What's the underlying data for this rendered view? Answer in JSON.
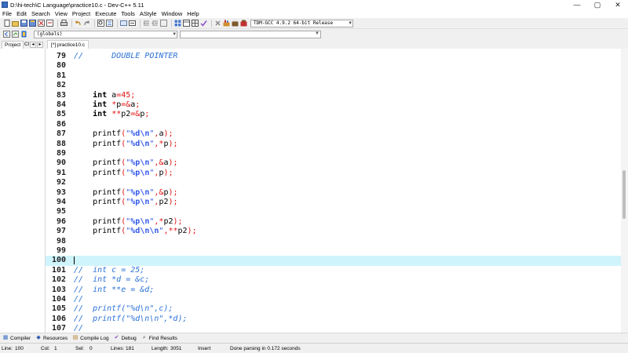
{
  "window": {
    "title": "D:\\hi-tech\\C Language\\practice10.c - Dev-C++ 5.11",
    "controls": [
      "—",
      "▢",
      "✕"
    ]
  },
  "menu": [
    "File",
    "Edit",
    "Search",
    "View",
    "Project",
    "Execute",
    "Tools",
    "AStyle",
    "Window",
    "Help"
  ],
  "toolbar": {
    "compiler_select": "TDM-GCC 4.9.2 64-bit Release",
    "scope_select": "(globals)",
    "members_select": ""
  },
  "panels": {
    "project_tab": "Project",
    "classes_tab": "Cl",
    "scroll_left": "◂",
    "scroll_right": "▸"
  },
  "editor": {
    "file_tab": "[*] practice10.c",
    "lines": [
      {
        "n": "79",
        "tokens": [
          [
            "comment",
            "//      DOUBLE POINTER"
          ]
        ]
      },
      {
        "n": "80",
        "tokens": []
      },
      {
        "n": "81",
        "tokens": []
      },
      {
        "n": "82",
        "tokens": []
      },
      {
        "n": "83",
        "tokens": [
          [
            "plain",
            "    "
          ],
          [
            "kw",
            "int"
          ],
          [
            "plain",
            " a"
          ],
          [
            "sym",
            "="
          ],
          [
            "num",
            "45"
          ],
          [
            "sym",
            ";"
          ]
        ]
      },
      {
        "n": "84",
        "tokens": [
          [
            "plain",
            "    "
          ],
          [
            "kw",
            "int"
          ],
          [
            "plain",
            " "
          ],
          [
            "sym",
            "*"
          ],
          [
            "plain",
            "p"
          ],
          [
            "sym",
            "=&"
          ],
          [
            "plain",
            "a"
          ],
          [
            "sym",
            ";"
          ]
        ]
      },
      {
        "n": "85",
        "tokens": [
          [
            "plain",
            "    "
          ],
          [
            "kw",
            "int"
          ],
          [
            "plain",
            " "
          ],
          [
            "sym",
            "**"
          ],
          [
            "plain",
            "p2"
          ],
          [
            "sym",
            "=&"
          ],
          [
            "plain",
            "p"
          ],
          [
            "sym",
            ";"
          ]
        ]
      },
      {
        "n": "86",
        "tokens": []
      },
      {
        "n": "87",
        "tokens": [
          [
            "plain",
            "    printf"
          ],
          [
            "sym",
            "("
          ],
          [
            "str",
            "\""
          ],
          [
            "fmt",
            "%d\\n"
          ],
          [
            "str",
            "\""
          ],
          [
            "sym",
            ","
          ],
          [
            "plain",
            "a"
          ],
          [
            "sym",
            ");"
          ]
        ]
      },
      {
        "n": "88",
        "tokens": [
          [
            "plain",
            "    printf"
          ],
          [
            "sym",
            "("
          ],
          [
            "str",
            "\""
          ],
          [
            "fmt",
            "%d\\n"
          ],
          [
            "str",
            "\""
          ],
          [
            "sym",
            ",*"
          ],
          [
            "plain",
            "p"
          ],
          [
            "sym",
            ");"
          ]
        ]
      },
      {
        "n": "89",
        "tokens": []
      },
      {
        "n": "90",
        "tokens": [
          [
            "plain",
            "    printf"
          ],
          [
            "sym",
            "("
          ],
          [
            "str",
            "\""
          ],
          [
            "fmt",
            "%p\\n"
          ],
          [
            "str",
            "\""
          ],
          [
            "sym",
            ",&"
          ],
          [
            "plain",
            "a"
          ],
          [
            "sym",
            ");"
          ]
        ]
      },
      {
        "n": "91",
        "tokens": [
          [
            "plain",
            "    printf"
          ],
          [
            "sym",
            "("
          ],
          [
            "str",
            "\""
          ],
          [
            "fmt",
            "%p\\n"
          ],
          [
            "str",
            "\""
          ],
          [
            "sym",
            ","
          ],
          [
            "plain",
            "p"
          ],
          [
            "sym",
            ");"
          ]
        ]
      },
      {
        "n": "92",
        "tokens": []
      },
      {
        "n": "93",
        "tokens": [
          [
            "plain",
            "    printf"
          ],
          [
            "sym",
            "("
          ],
          [
            "str",
            "\""
          ],
          [
            "fmt",
            "%p\\n"
          ],
          [
            "str",
            "\""
          ],
          [
            "sym",
            ",&"
          ],
          [
            "plain",
            "p"
          ],
          [
            "sym",
            ");"
          ]
        ]
      },
      {
        "n": "94",
        "tokens": [
          [
            "plain",
            "    printf"
          ],
          [
            "sym",
            "("
          ],
          [
            "str",
            "\""
          ],
          [
            "fmt",
            "%p\\n"
          ],
          [
            "str",
            "\""
          ],
          [
            "sym",
            ","
          ],
          [
            "plain",
            "p2"
          ],
          [
            "sym",
            ");"
          ]
        ]
      },
      {
        "n": "95",
        "tokens": []
      },
      {
        "n": "96",
        "tokens": [
          [
            "plain",
            "    printf"
          ],
          [
            "sym",
            "("
          ],
          [
            "str",
            "\""
          ],
          [
            "fmt",
            "%p\\n"
          ],
          [
            "str",
            "\""
          ],
          [
            "sym",
            ",*"
          ],
          [
            "plain",
            "p2"
          ],
          [
            "sym",
            ");"
          ]
        ]
      },
      {
        "n": "97",
        "tokens": [
          [
            "plain",
            "    printf"
          ],
          [
            "sym",
            "("
          ],
          [
            "str",
            "\""
          ],
          [
            "fmt",
            "%d\\n\\n"
          ],
          [
            "str",
            "\""
          ],
          [
            "sym",
            ",**"
          ],
          [
            "plain",
            "p2"
          ],
          [
            "sym",
            ");"
          ]
        ]
      },
      {
        "n": "98",
        "tokens": []
      },
      {
        "n": "99",
        "tokens": []
      },
      {
        "n": "100",
        "tokens": [],
        "current": true
      },
      {
        "n": "101",
        "tokens": [
          [
            "comment",
            "//  int c = 25;"
          ]
        ]
      },
      {
        "n": "102",
        "tokens": [
          [
            "comment",
            "//  int *d = &c;"
          ]
        ]
      },
      {
        "n": "103",
        "tokens": [
          [
            "comment",
            "//  int **e = &d;"
          ]
        ]
      },
      {
        "n": "104",
        "tokens": [
          [
            "comment",
            "//"
          ]
        ]
      },
      {
        "n": "105",
        "tokens": [
          [
            "comment",
            "//  printf(\"%d\\n\",c);"
          ]
        ]
      },
      {
        "n": "106",
        "tokens": [
          [
            "comment",
            "//  printf(\"%d\\n\\n\",*d);"
          ]
        ]
      },
      {
        "n": "107",
        "tokens": [
          [
            "comment",
            "//"
          ]
        ]
      }
    ]
  },
  "bottom_tabs": [
    {
      "icon": "compiler-icon",
      "glyph": "▦",
      "label": "Compiler"
    },
    {
      "icon": "resources-icon",
      "glyph": "◆",
      "label": "Resources"
    },
    {
      "icon": "compile-log-icon",
      "glyph": "▤",
      "label": "Compile Log"
    },
    {
      "icon": "debug-icon",
      "glyph": "✔",
      "label": "Debug"
    },
    {
      "icon": "find-results-icon",
      "glyph": "⌕",
      "label": "Find Results"
    }
  ],
  "status": {
    "line_label": "Line:",
    "line_value": "100",
    "col_label": "Col:",
    "col_value": "1",
    "sel_label": "Sel:",
    "sel_value": "0",
    "lines_label": "Lines:",
    "lines_value": "181",
    "length_label": "Length:",
    "length_value": "3051",
    "mode": "Insert",
    "message": "Done parsing in 0.172 seconds"
  },
  "colors": {
    "current_line": "#cff4fb",
    "comment": "#2b72d6",
    "string": "#3157e8",
    "symbol": "#e01212"
  }
}
